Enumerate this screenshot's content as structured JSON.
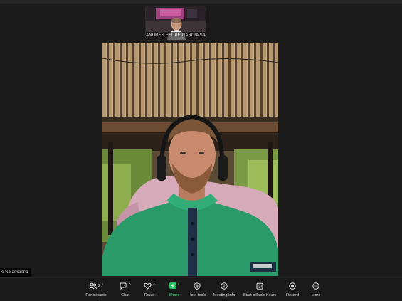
{
  "thumbnail": {
    "participant_name": "ANDRÉS FELIPE GARCIA SA"
  },
  "main_video": {
    "participant_name": "s Salamanca"
  },
  "toolbar": {
    "participants": {
      "label": "Participants",
      "count": "2",
      "icon": "participants-icon"
    },
    "chat": {
      "label": "Chat",
      "icon": "chat-icon"
    },
    "react": {
      "label": "React",
      "icon": "heart-icon"
    },
    "share": {
      "label": "Share",
      "icon": "share-arrow-icon",
      "color": "#22c05b"
    },
    "host_tools": {
      "label": "Host tools",
      "icon": "shield-icon"
    },
    "meeting_info": {
      "label": "Meeting info",
      "icon": "info-icon"
    },
    "billable": {
      "label": "Start billable hours",
      "icon": "clock-icon"
    },
    "record": {
      "label": "Record",
      "icon": "record-icon"
    },
    "more": {
      "label": "More",
      "icon": "more-icon"
    }
  }
}
